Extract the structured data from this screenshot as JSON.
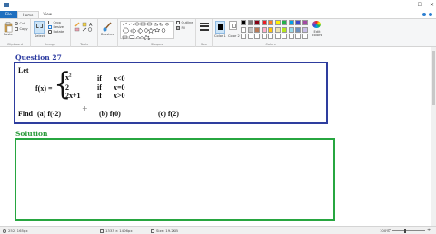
{
  "window": {
    "controls": [
      "—",
      "☐",
      "✕"
    ]
  },
  "menu": {
    "tabs": [
      "File",
      "Home",
      "View"
    ]
  },
  "ribbon": {
    "clipboard": {
      "paste": "Paste",
      "cut": "Cut",
      "copy": "Copy",
      "label": "Clipboard"
    },
    "image": {
      "select": "Select",
      "crop": "Crop",
      "resize": "Resize",
      "rotate": "Rotate",
      "label": "Image"
    },
    "tools": {
      "label": "Tools"
    },
    "brushes": {
      "label": "Brushes"
    },
    "shapes": {
      "outline": "Outline",
      "fill": "Fill",
      "label": "Shapes"
    },
    "size": {
      "label": "Size"
    },
    "colors": {
      "color1": "Color 1",
      "color2": "Color 2",
      "edit": "Edit colors",
      "label": "Colors",
      "palette_row1": [
        "#000000",
        "#7f7f7f",
        "#880015",
        "#ed1c24",
        "#ff7f27",
        "#fff200",
        "#22b14c",
        "#00a2e8",
        "#3f48cc",
        "#a349a4"
      ],
      "palette_row2": [
        "#ffffff",
        "#c3c3c3",
        "#b97a57",
        "#ffaec9",
        "#ffc90e",
        "#efe4b0",
        "#b5e61d",
        "#99d9ea",
        "#7092be",
        "#c8bfe7"
      ],
      "palette_row3": [
        "#ffffff",
        "#ffffff",
        "#ffffff",
        "#ffffff",
        "#ffffff",
        "#ffffff",
        "#ffffff",
        "#ffffff",
        "#ffffff",
        "#ffffff"
      ]
    }
  },
  "document": {
    "question_title": "Question 27",
    "let": "Let",
    "fx": "f(x) =",
    "cases": [
      {
        "expr": "x",
        "sup": "2",
        "cond_if": "if",
        "cond": "x<0"
      },
      {
        "expr": "2",
        "sup": "",
        "cond_if": "if",
        "cond": "x=0"
      },
      {
        "expr": "2x+1",
        "sup": "",
        "cond_if": "if",
        "cond": "x>0"
      }
    ],
    "find": "Find",
    "parts": [
      "(a)  f(-2)",
      "(b) f(0)",
      "(c) f(2)"
    ],
    "solution_title": "Solution"
  },
  "status": {
    "cursor_pos": "252, 165px",
    "image_dims": "1333 × 1406px",
    "file_size": "Size: 19.2KB",
    "zoom": "100%"
  }
}
